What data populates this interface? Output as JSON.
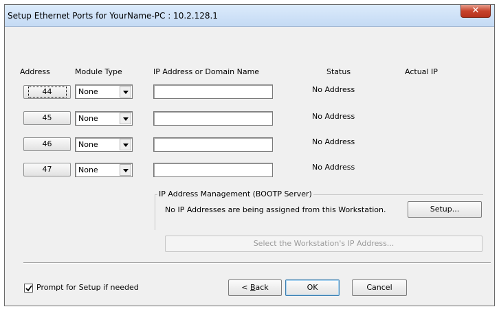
{
  "window": {
    "title": "Setup Ethernet Ports for YourName-PC : 10.2.128.1",
    "close_glyph": "✕"
  },
  "columns": {
    "address": "Address",
    "module_type": "Module Type",
    "ip": "IP Address or Domain Name",
    "status": "Status",
    "actual_ip": "Actual IP"
  },
  "rows": [
    {
      "address": "44",
      "module_type": "None",
      "ip": "",
      "status": "No Address",
      "actual_ip": ""
    },
    {
      "address": "45",
      "module_type": "None",
      "ip": "",
      "status": "No Address",
      "actual_ip": ""
    },
    {
      "address": "46",
      "module_type": "None",
      "ip": "",
      "status": "No Address",
      "actual_ip": ""
    },
    {
      "address": "47",
      "module_type": "None",
      "ip": "",
      "status": "No Address",
      "actual_ip": ""
    }
  ],
  "bootp": {
    "legend": "IP Address Management (BOOTP Server)",
    "message": "No IP Addresses are being assigned from this Workstation.",
    "setup_label": "Setup...",
    "select_ip_label": "Select the Workstation's IP Address..."
  },
  "footer": {
    "prompt_label": "Prompt for Setup if needed",
    "prompt_checked": true,
    "back_label": "< Back",
    "back_mnemonic_prefix": "< ",
    "back_mnemonic_char": "B",
    "back_mnemonic_rest": "ack",
    "ok_label": "OK",
    "cancel_label": "Cancel"
  },
  "icons": {
    "close": "close-icon",
    "dropdown": "chevron-down-icon",
    "check": "checkmark-icon"
  }
}
